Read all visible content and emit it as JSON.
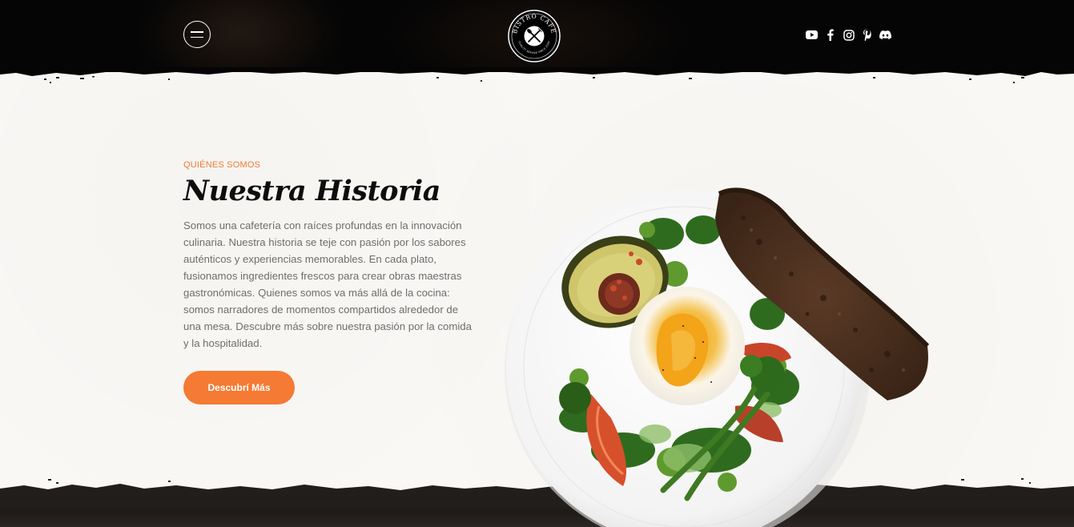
{
  "header": {
    "logo": {
      "top_text": "BISTRO CAFE",
      "bottom_text": "QUALITY SERVICE SINCE 2020"
    },
    "menu_icon": "hamburger-icon",
    "social": [
      {
        "name": "youtube-icon"
      },
      {
        "name": "facebook-icon"
      },
      {
        "name": "instagram-icon"
      },
      {
        "name": "pinterest-icon"
      },
      {
        "name": "discord-icon"
      }
    ]
  },
  "about": {
    "eyebrow": "QUIÉNES SOMOS",
    "title": "Nuestra Historia",
    "body": "Somos una cafetería con raíces profundas en la innovación culinaria. Nuestra historia se teje con pasión por los sabores auténticos y experiencias memorables. En cada plato, fusionamos ingredientes frescos para crear obras maestras gastronómicas. Quienes somos va más allá de la cocina: somos narradores de momentos compartidos alrededor de una mesa. Descubre más sobre nuestra pasión por la comida y la hospitalidad.",
    "cta_label": "Descubrí Más"
  },
  "colors": {
    "accent": "#f57a33",
    "header_bg": "#050505",
    "paper_bg": "#faf8f5",
    "title": "#0d0d0d",
    "body": "#6e6e6e"
  }
}
